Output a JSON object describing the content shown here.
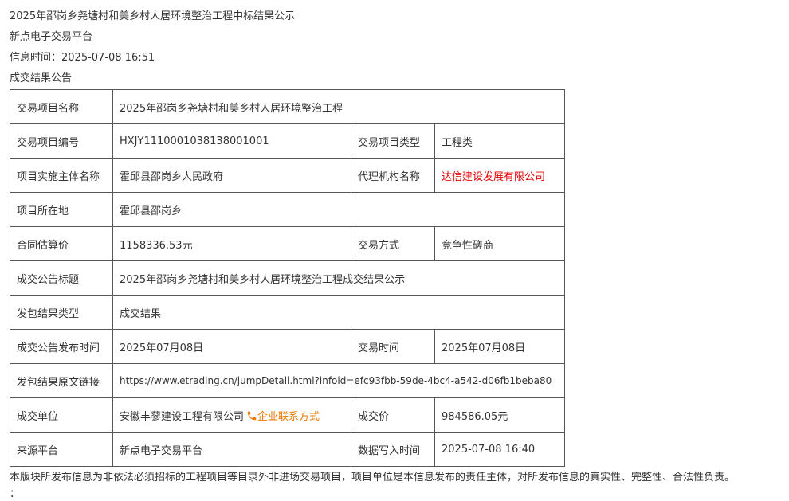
{
  "header": {
    "title": "2025年邵岗乡尧塘村和美乡村人居环境整治工程中标结果公示",
    "platform": "新点电子交易平台",
    "info_time": "信息时间：2025-07-08 16:51",
    "section_title": "成交结果公告"
  },
  "table": {
    "project_name_label": "交易项目名称",
    "project_name": "2025年邵岗乡尧塘村和美乡村人居环境整治工程",
    "project_code_label": "交易项目编号",
    "project_code": "HXJY1110001038138001001",
    "project_type_label": "交易项目类型",
    "project_type": "工程类",
    "owner_label": "项目实施主体名称",
    "owner": "霍邱县邵岗乡人民政府",
    "agency_label": "代理机构名称",
    "agency": "达信建设发展有限公司",
    "location_label": "项目所在地",
    "location": "霍邱县邵岗乡",
    "estimate_label": "合同估算价",
    "estimate": "1158336.53元",
    "method_label": "交易方式",
    "method": "竞争性磋商",
    "notice_title_label": "成交公告标题",
    "notice_title": "2025年邵岗乡尧塘村和美乡村人居环境整治工程成交结果公示",
    "result_type_label": "发包结果类型",
    "result_type": "成交结果",
    "publish_time_label": "成交公告发布时间",
    "publish_time": "2025年07月08日",
    "trade_time_label": "交易时间",
    "trade_time": "2025年07月08日",
    "link_label": "发包结果原文链接",
    "link": "https://www.etrading.cn/jumpDetail.html?infoid=efc93fbb-59de-4bc4-a542-d06fb1beba80",
    "winner_label": "成交单位",
    "winner": "安徽丰蓼建设工程有限公司",
    "contact_link": "企业联系方式",
    "price_label": "成交价",
    "price": "984586.05元",
    "source_label": "来源平台",
    "source": "新点电子交易平台",
    "write_time_label": "数据写入时间",
    "write_time": "2025-07-08 16:40"
  },
  "footer": {
    "note": "本版块所发布信息为非依法必须招标的工程项目等目录外非进场交易项目，项目单位是本信息发布的责任主体，对所发布信息的真实性、完整性、合法性负责。",
    "colon": "："
  },
  "colors": {
    "agency_red": "#e60000",
    "contact_orange": "#f07800"
  },
  "icons": {
    "contact": "phone-icon"
  }
}
